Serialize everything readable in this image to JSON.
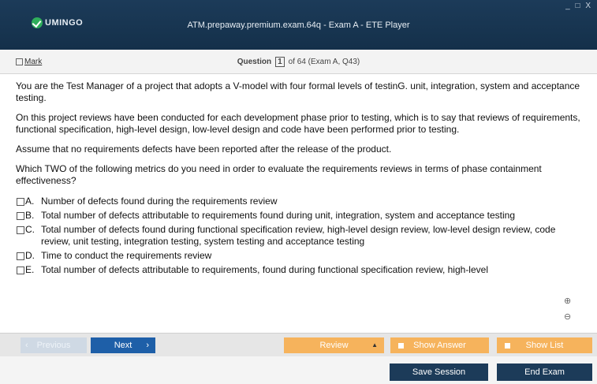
{
  "window": {
    "logo_text": "UMINGO",
    "title": "ATM.prepaway.premium.exam.64q - Exam A - ETE Player",
    "controls": "_ □ X"
  },
  "question_bar": {
    "mark_label": "Mark",
    "question_label": "Question",
    "current": "1",
    "of_text": "of 64 (Exam A, Q43)"
  },
  "question": {
    "paragraphs": [
      "You are the Test Manager of a project that adopts a V-model with four formal levels of testinG. unit, integration, system and acceptance testing.",
      "On this project reviews have been conducted for each development phase prior to testing, which is to say that reviews of requirements, functional specification, high-level design, low-level design and code have been performed prior to testing.",
      "Assume that no requirements defects have been reported after the release of the product.",
      "Which TWO of the following metrics do you need in order to evaluate the requirements reviews in terms of phase containment effectiveness?"
    ],
    "options": [
      {
        "letter": "A.",
        "text": "Number of defects found during the requirements review"
      },
      {
        "letter": "B.",
        "text": "Total number of defects attributable to requirements found during unit, integration, system and acceptance testing"
      },
      {
        "letter": "C.",
        "text": "Total number of defects found during functional specification review, high-level design review, low-level design review, code review, unit testing, integration testing, system testing and acceptance testing"
      },
      {
        "letter": "D.",
        "text": "Time to conduct the requirements review"
      },
      {
        "letter": "E.",
        "text": "Total number of defects attributable to requirements, found during functional specification review, high-level"
      }
    ]
  },
  "zoom": {
    "zoom_in": "⊕",
    "zoom_out": "⊖"
  },
  "toolbar": {
    "previous": "Previous",
    "next": "Next",
    "review": "Review",
    "show_answer": "Show Answer",
    "show_list": "Show List"
  },
  "bottom": {
    "save_session": "Save Session",
    "end_exam": "End Exam"
  }
}
